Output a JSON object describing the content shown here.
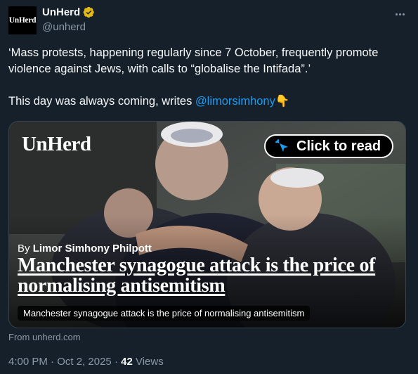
{
  "account": {
    "avatar_text": "UnHerd",
    "display_name": "UnHerd",
    "handle": "@unherd"
  },
  "icons": {
    "verified": "verified-badge-icon",
    "more": "more-options-icon",
    "pointing_down": "pointing-down-emoji-icon",
    "cursor": "cursor-click-icon"
  },
  "tweet": {
    "line1": "‘Mass protests, happening regularly since 7 October, frequently promote violence against Jews, with calls to “globalise the Intifada”.’",
    "line2_prefix": "This day was always coming, writes ",
    "mention": "@limorsimhony",
    "emoji": "👇"
  },
  "card": {
    "brand": "UnHerd",
    "cta_label": "Click to read",
    "byline_prefix": "By",
    "byline_author": "Limor Simhony Philpott",
    "headline": "Manchester synagogue attack is the price of normalising antisemitism",
    "caption": "Manchester synagogue attack is the price of normalising antisemitism"
  },
  "source": "From unherd.com",
  "meta": {
    "time": "4:00 PM",
    "sep": " · ",
    "date": "Oct 2, 2025",
    "views_count": "42",
    "views_label": " Views"
  },
  "colors": {
    "background": "#15202b",
    "link": "#1d9bf0",
    "secondary_text": "#8b98a5",
    "verified_gold": "#e2b719"
  }
}
